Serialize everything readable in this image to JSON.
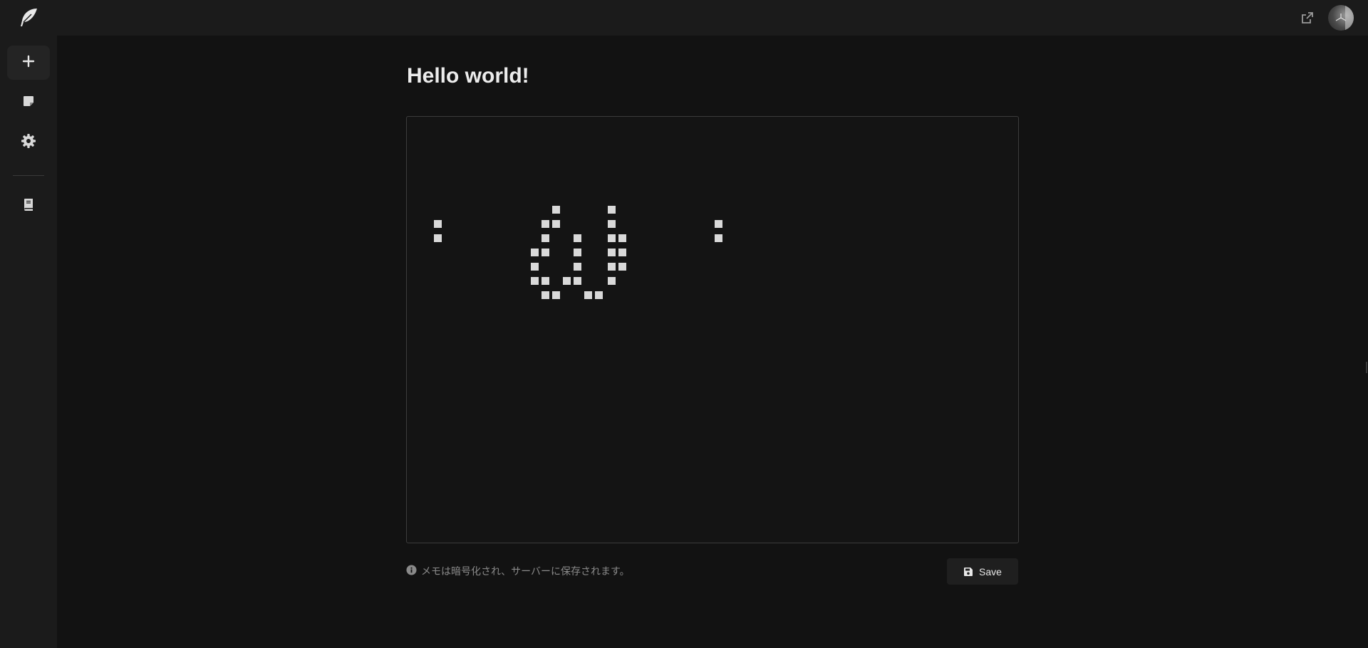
{
  "app": {
    "logo_icon": "feather-icon"
  },
  "header": {
    "external_link_icon": "external-link-icon",
    "avatar_icon": "avatar"
  },
  "sidebar": {
    "items": [
      {
        "icon": "plus-icon",
        "active": true
      },
      {
        "icon": "note-icon",
        "active": false
      },
      {
        "icon": "gear-icon",
        "active": false
      },
      {
        "icon": "book-icon",
        "active": false
      }
    ]
  },
  "main": {
    "title": "Hello world!",
    "note_content": "pixel-art drawing",
    "info_text": "メモは暗号化され、サーバーに保存されます。",
    "save_label": "Save"
  },
  "colors": {
    "background": "#121212",
    "panel": "#1b1b1b",
    "pixel": "#d9d9d9",
    "muted_text": "#8a8a8a"
  }
}
